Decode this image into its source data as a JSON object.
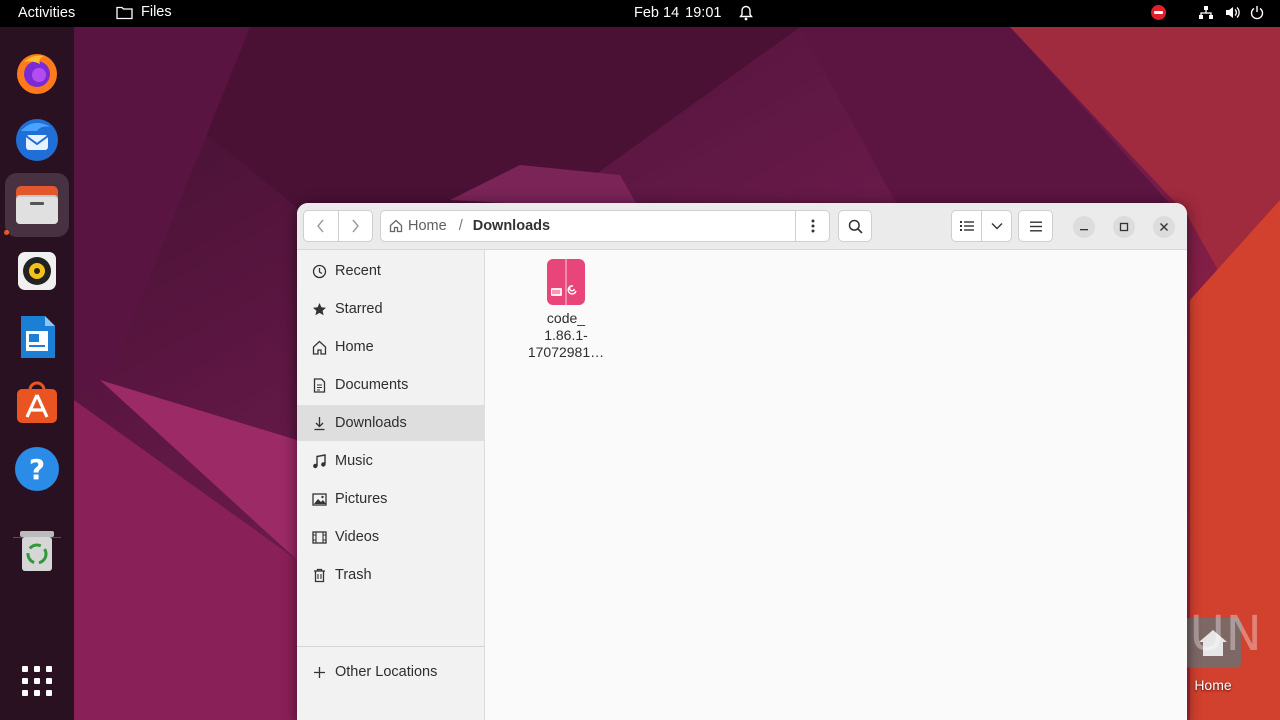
{
  "topbar": {
    "activities": "Activities",
    "app_name": "Files",
    "date": "Feb 14",
    "time": "19:01"
  },
  "dock": {
    "items": [
      "Firefox",
      "Thunderbird",
      "Files",
      "Rhythmbox",
      "LibreOffice Writer",
      "Ubuntu Software",
      "Help",
      "Trash"
    ],
    "active": "Files"
  },
  "window": {
    "path": {
      "home": "Home",
      "separator": "/",
      "current": "Downloads"
    },
    "sidebar": {
      "items": [
        {
          "label": "Recent",
          "icon": "clock-icon"
        },
        {
          "label": "Starred",
          "icon": "star-icon"
        },
        {
          "label": "Home",
          "icon": "home-icon"
        },
        {
          "label": "Documents",
          "icon": "document-icon"
        },
        {
          "label": "Downloads",
          "icon": "download-icon",
          "selected": true
        },
        {
          "label": "Music",
          "icon": "music-icon"
        },
        {
          "label": "Pictures",
          "icon": "pictures-icon"
        },
        {
          "label": "Videos",
          "icon": "videos-icon"
        },
        {
          "label": "Trash",
          "icon": "trash-icon"
        }
      ],
      "other_locations": "Other Locations"
    },
    "files": [
      {
        "name": "code_\n1.86.1-\n17072981…",
        "icon": "deb-package-icon"
      }
    ]
  },
  "desktop": {
    "home_label": "Home",
    "watermark": "ANY RUN"
  },
  "colors": {
    "accent": "#e95420",
    "deb_icon": "#e8457a",
    "topbar": "#000000"
  }
}
